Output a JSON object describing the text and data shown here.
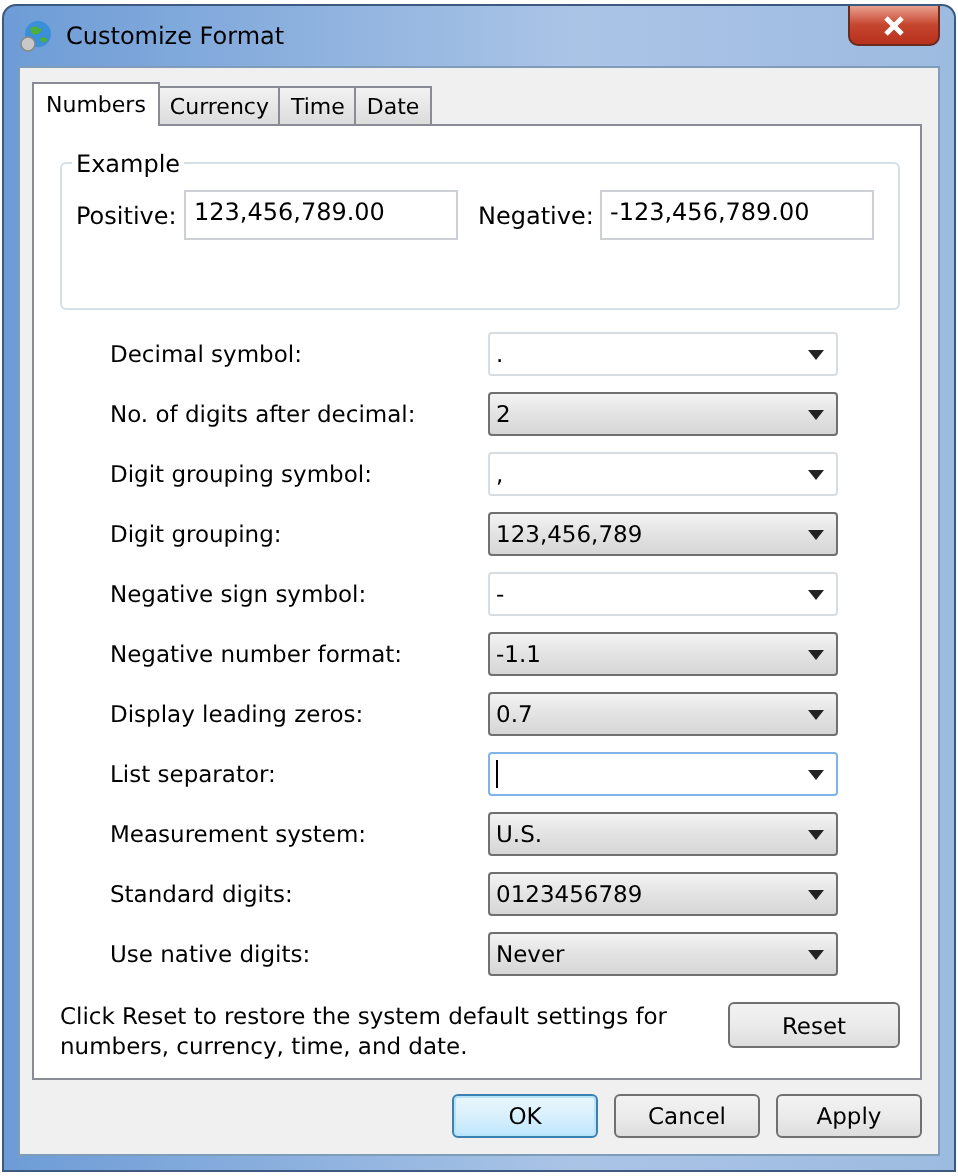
{
  "window": {
    "title": "Customize Format"
  },
  "tabs": [
    {
      "label": "Numbers",
      "selected": true
    },
    {
      "label": "Currency",
      "selected": false
    },
    {
      "label": "Time",
      "selected": false
    },
    {
      "label": "Date",
      "selected": false
    }
  ],
  "example": {
    "title": "Example",
    "positive_label": "Positive:",
    "positive_value": "123,456,789.00",
    "negative_label": "Negative:",
    "negative_value": "-123,456,789.00"
  },
  "settings": [
    {
      "label": "Decimal symbol:",
      "value": ".",
      "kind": "editable",
      "focused": false
    },
    {
      "label": "No. of digits after decimal:",
      "value": "2",
      "kind": "list",
      "focused": false
    },
    {
      "label": "Digit grouping symbol:",
      "value": ",",
      "kind": "editable",
      "focused": false
    },
    {
      "label": "Digit grouping:",
      "value": "123,456,789",
      "kind": "list",
      "focused": false
    },
    {
      "label": "Negative sign symbol:",
      "value": "-",
      "kind": "editable",
      "focused": false
    },
    {
      "label": "Negative number format:",
      "value": "-1.1",
      "kind": "list",
      "focused": false
    },
    {
      "label": "Display leading zeros:",
      "value": "0.7",
      "kind": "list",
      "focused": false
    },
    {
      "label": "List separator:",
      "kind": "editable",
      "focused": true
    },
    {
      "label": "Measurement system:",
      "value": "U.S.",
      "kind": "list",
      "focused": false
    },
    {
      "label": "Standard digits:",
      "value": "0123456789",
      "kind": "list",
      "focused": false
    },
    {
      "label": "Use native digits:",
      "value": "Never",
      "kind": "list",
      "focused": false
    }
  ],
  "reset_note": "Click Reset to restore the system default settings for numbers, currency, time, and date.",
  "reset_button": "Reset",
  "buttons": [
    {
      "label": "OK",
      "default": true
    },
    {
      "label": "Cancel",
      "default": false
    },
    {
      "label": "Apply",
      "default": false
    }
  ]
}
